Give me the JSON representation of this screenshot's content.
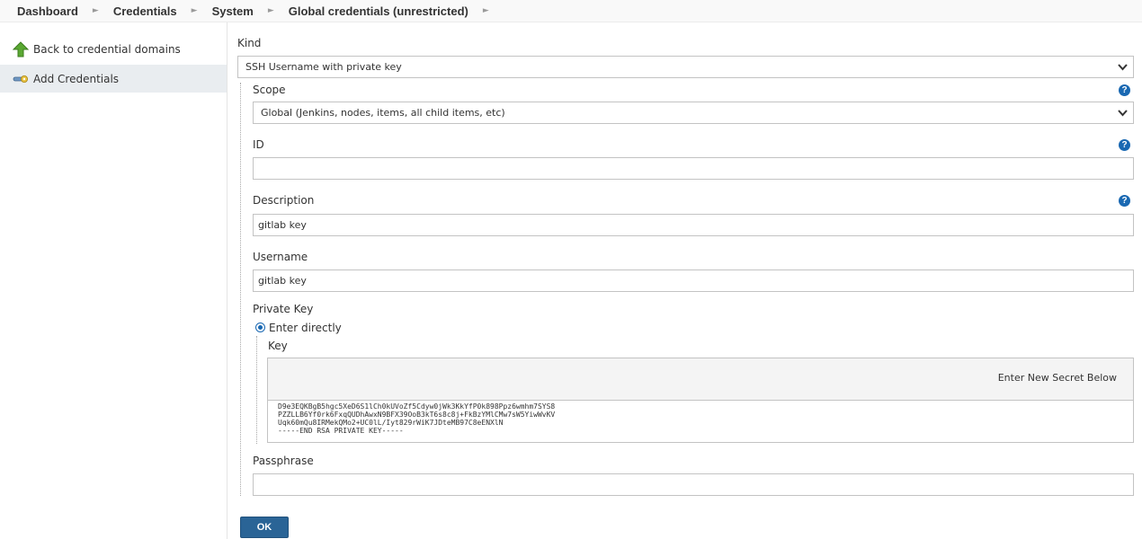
{
  "breadcrumb": {
    "items": [
      "Dashboard",
      "Credentials",
      "System",
      "Global credentials (unrestricted)"
    ],
    "separator": "►"
  },
  "sidebar": {
    "items": [
      {
        "label": "Back to credential domains",
        "icon": "up-arrow-icon"
      },
      {
        "label": "Add Credentials",
        "icon": "key-icon"
      }
    ]
  },
  "form": {
    "kind": {
      "label": "Kind",
      "value": "SSH Username with private key"
    },
    "scope": {
      "label": "Scope",
      "value": "Global (Jenkins, nodes, items, all child items, etc)"
    },
    "id": {
      "label": "ID",
      "value": ""
    },
    "description": {
      "label": "Description",
      "value": "gitlab key"
    },
    "username": {
      "label": "Username",
      "value": "gitlab key"
    },
    "private_key": {
      "label": "Private Key",
      "option_label": "Enter directly",
      "key_label": "Key",
      "secret_text": "Enter New Secret Below",
      "key_lines": [
        "D9e3EQKBgB5hgc5XeD6S1lCh0kUVoZf5Cdyw0jWk3KkYfP0k898Ppz6wmhm7SYS8",
        "PZZLLB6Yf0rk6FxqQUDhAwxN9BFX39OoB3kT6s8c8j+FkBzYMlCMw7sW5YiwWvKV",
        "Uqk60mQu8IRMekQMo2+UC0lL/Iyt829rWiK7JDteMB97C8eENXlN",
        "-----END RSA PRIVATE KEY-----"
      ]
    },
    "passphrase": {
      "label": "Passphrase",
      "value": ""
    },
    "help_glyph": "?",
    "ok_label": "OK"
  },
  "colors": {
    "accent": "#1968b2",
    "button": "#2a6496",
    "active_sidebar": "#e9edf0"
  }
}
